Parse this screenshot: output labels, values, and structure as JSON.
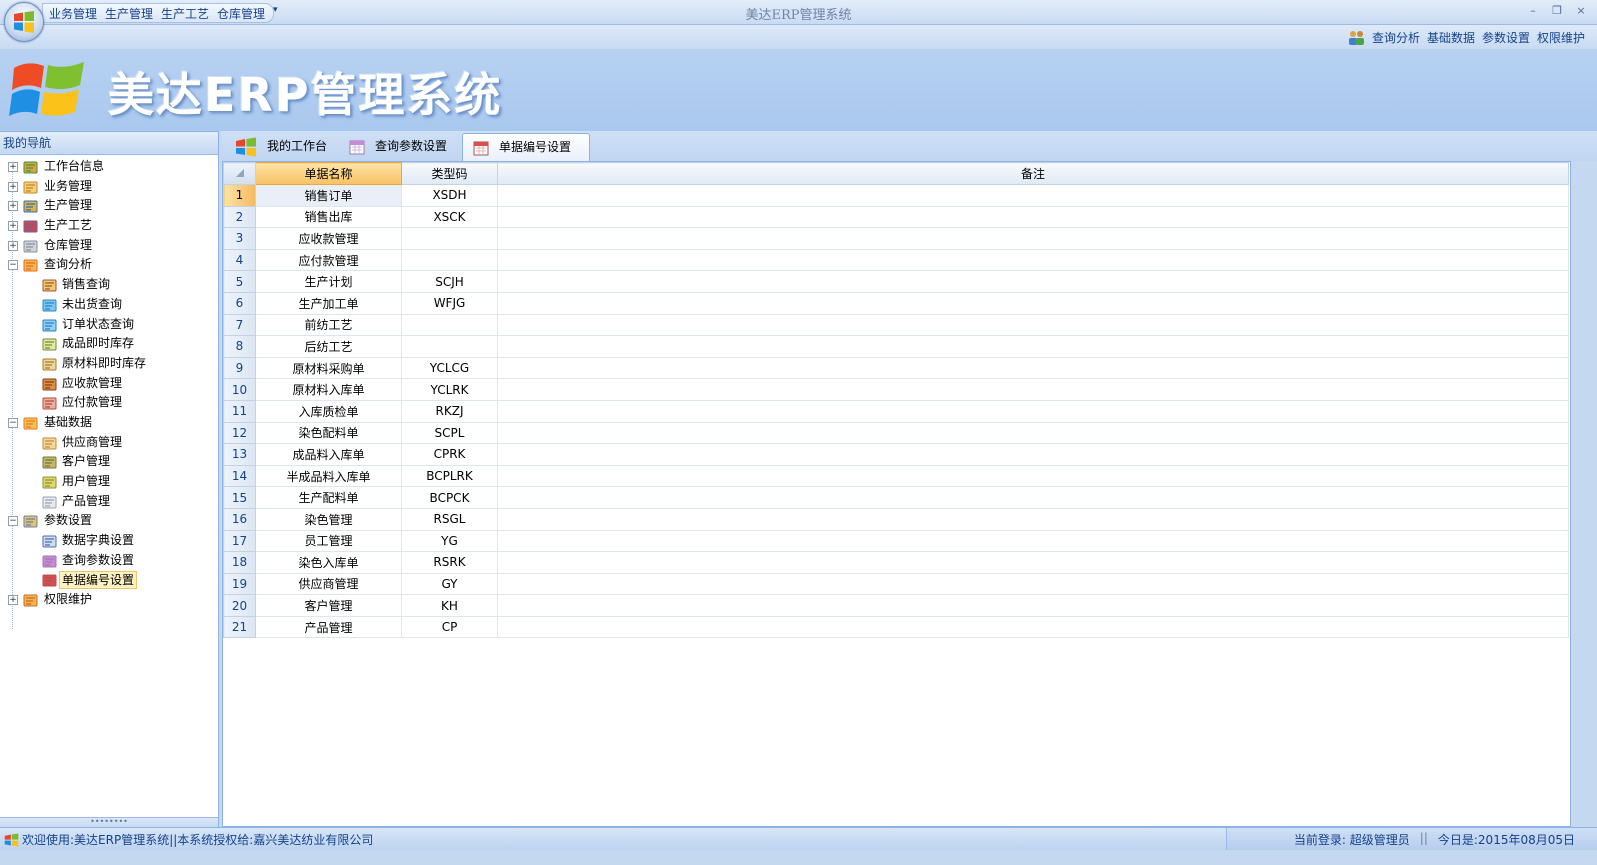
{
  "window": {
    "title": "美达ERP管理系统",
    "quick_access": [
      "业务管理",
      "生产管理",
      "生产工艺",
      "仓库管理"
    ],
    "qat_dropdown": "▾",
    "minimize": "–",
    "restore": "❐",
    "close": "×"
  },
  "top_links": [
    "查询分析",
    "基础数据",
    "参数设置",
    "权限维护"
  ],
  "banner": {
    "title": "美达ERP管理系统"
  },
  "nav": {
    "header": "我的导航",
    "items": [
      {
        "label": "工作台信息",
        "level": 0,
        "toggle": "+",
        "icon": "workbench-icon"
      },
      {
        "label": "业务管理",
        "level": 0,
        "toggle": "+",
        "icon": "business-icon"
      },
      {
        "label": "生产管理",
        "level": 0,
        "toggle": "+",
        "icon": "production-icon"
      },
      {
        "label": "生产工艺",
        "level": 0,
        "toggle": "+",
        "icon": "process-icon"
      },
      {
        "label": "仓库管理",
        "level": 0,
        "toggle": "+",
        "icon": "warehouse-icon"
      },
      {
        "label": "查询分析",
        "level": 0,
        "toggle": "−",
        "icon": "query-icon"
      },
      {
        "label": "销售查询",
        "level": 1,
        "icon": "sales-query-icon"
      },
      {
        "label": "未出货查询",
        "level": 1,
        "icon": "unshipped-icon"
      },
      {
        "label": "订单状态查询",
        "level": 1,
        "icon": "order-status-icon"
      },
      {
        "label": "成品即时库存",
        "level": 1,
        "icon": "product-stock-icon"
      },
      {
        "label": "原材料即时库存",
        "level": 1,
        "icon": "material-stock-icon"
      },
      {
        "label": "应收款管理",
        "level": 1,
        "icon": "receivable-icon"
      },
      {
        "label": "应付款管理",
        "level": 1,
        "icon": "payable-icon"
      },
      {
        "label": "基础数据",
        "level": 0,
        "toggle": "−",
        "icon": "base-data-icon"
      },
      {
        "label": "供应商管理",
        "level": 1,
        "icon": "supplier-icon"
      },
      {
        "label": "客户管理",
        "level": 1,
        "icon": "customer-icon"
      },
      {
        "label": "用户管理",
        "level": 1,
        "icon": "user-icon"
      },
      {
        "label": "产品管理",
        "level": 1,
        "icon": "product-icon"
      },
      {
        "label": "参数设置",
        "level": 0,
        "toggle": "−",
        "icon": "settings-icon"
      },
      {
        "label": "数据字典设置",
        "level": 1,
        "icon": "dictionary-icon"
      },
      {
        "label": "查询参数设置",
        "level": 1,
        "icon": "query-param-icon"
      },
      {
        "label": "单据编号设置",
        "level": 1,
        "icon": "doc-number-icon",
        "selected": true
      },
      {
        "label": "权限维护",
        "level": 0,
        "toggle": "+",
        "icon": "permission-icon"
      }
    ],
    "grip": "••••••••"
  },
  "tabs": [
    {
      "label": "我的工作台",
      "icon": "windows-logo-icon"
    },
    {
      "label": "查询参数设置",
      "icon": "calendar-icon"
    },
    {
      "label": "单据编号设置",
      "icon": "calendar-red-icon",
      "active": true
    }
  ],
  "grid": {
    "columns": [
      "单据名称",
      "类型码",
      "备注"
    ],
    "rows": [
      {
        "n": "1",
        "name": "销售订单",
        "code": "XSDH",
        "note": ""
      },
      {
        "n": "2",
        "name": "销售出库",
        "code": "XSCK",
        "note": ""
      },
      {
        "n": "3",
        "name": "应收款管理",
        "code": "",
        "note": ""
      },
      {
        "n": "4",
        "name": "应付款管理",
        "code": "",
        "note": ""
      },
      {
        "n": "5",
        "name": "生产计划",
        "code": "SCJH",
        "note": ""
      },
      {
        "n": "6",
        "name": "生产加工单",
        "code": "WFJG",
        "note": ""
      },
      {
        "n": "7",
        "name": "前纺工艺",
        "code": "",
        "note": ""
      },
      {
        "n": "8",
        "name": "后纺工艺",
        "code": "",
        "note": ""
      },
      {
        "n": "9",
        "name": "原材料采购单",
        "code": "YCLCG",
        "note": ""
      },
      {
        "n": "10",
        "name": "原材料入库单",
        "code": "YCLRK",
        "note": ""
      },
      {
        "n": "11",
        "name": "入库质检单",
        "code": "RKZJ",
        "note": ""
      },
      {
        "n": "12",
        "name": "染色配料单",
        "code": "SCPL",
        "note": ""
      },
      {
        "n": "13",
        "name": "成品料入库单",
        "code": "CPRK",
        "note": ""
      },
      {
        "n": "14",
        "name": "半成品料入库单",
        "code": "BCPLRK",
        "note": ""
      },
      {
        "n": "15",
        "name": "生产配料单",
        "code": "BCPCK",
        "note": ""
      },
      {
        "n": "16",
        "name": "染色管理",
        "code": "RSGL",
        "note": ""
      },
      {
        "n": "17",
        "name": "员工管理",
        "code": "YG",
        "note": ""
      },
      {
        "n": "18",
        "name": "染色入库单",
        "code": "RSRK",
        "note": ""
      },
      {
        "n": "19",
        "name": "供应商管理",
        "code": "GY",
        "note": ""
      },
      {
        "n": "20",
        "name": "客户管理",
        "code": "KH",
        "note": ""
      },
      {
        "n": "21",
        "name": "产品管理",
        "code": "CP",
        "note": ""
      }
    ]
  },
  "status": {
    "welcome": "欢迎使用:美达ERP管理系统||本系统授权给:嘉兴美达纺业有限公司",
    "login": "当前登录: 超级管理员",
    "separator": "||",
    "today": "今日是:2015年08月05日"
  },
  "colors": {
    "accent": "#15428b",
    "selected": "#fde3a6",
    "panel": "#c4d8f0"
  }
}
